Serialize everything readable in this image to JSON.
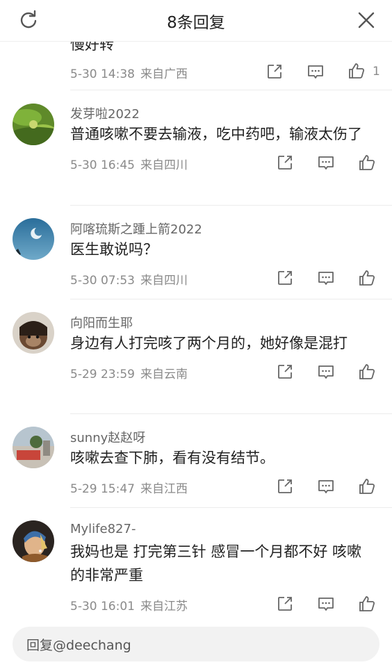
{
  "header": {
    "title": "8条回复"
  },
  "partial": {
    "cut_text": "慢好转",
    "date": "5-30 14:38",
    "location": "来自广西",
    "like_count": "1"
  },
  "comments": [
    {
      "user": "发芽啦2022",
      "text": "普通咳嗽不要去输液，吃中药吧，输液太伤了",
      "date": "5-30 16:45",
      "location": "来自四川"
    },
    {
      "user": "阿喀琉斯之踵上箭2022",
      "text": "医生敢说吗？",
      "date": "5-30 07:53",
      "location": "来自四川"
    },
    {
      "user": "向阳而生耶",
      "text": "身边有人打完咳了两个月的，她好像是混打",
      "date": "5-29 23:59",
      "location": "来自云南"
    },
    {
      "user": "sunny赵赵呀",
      "text": "咳嗽去查下肺，看有没有结节。",
      "date": "5-29 15:47",
      "location": "来自江西"
    },
    {
      "user": "Mylife827-",
      "text": "我妈也是 打完第三针 感冒一个月都不好 咳嗽的非常严重",
      "date": "5-30 16:01",
      "location": "来自江苏"
    }
  ],
  "reply_bar": {
    "placeholder": "回复@deechang"
  }
}
